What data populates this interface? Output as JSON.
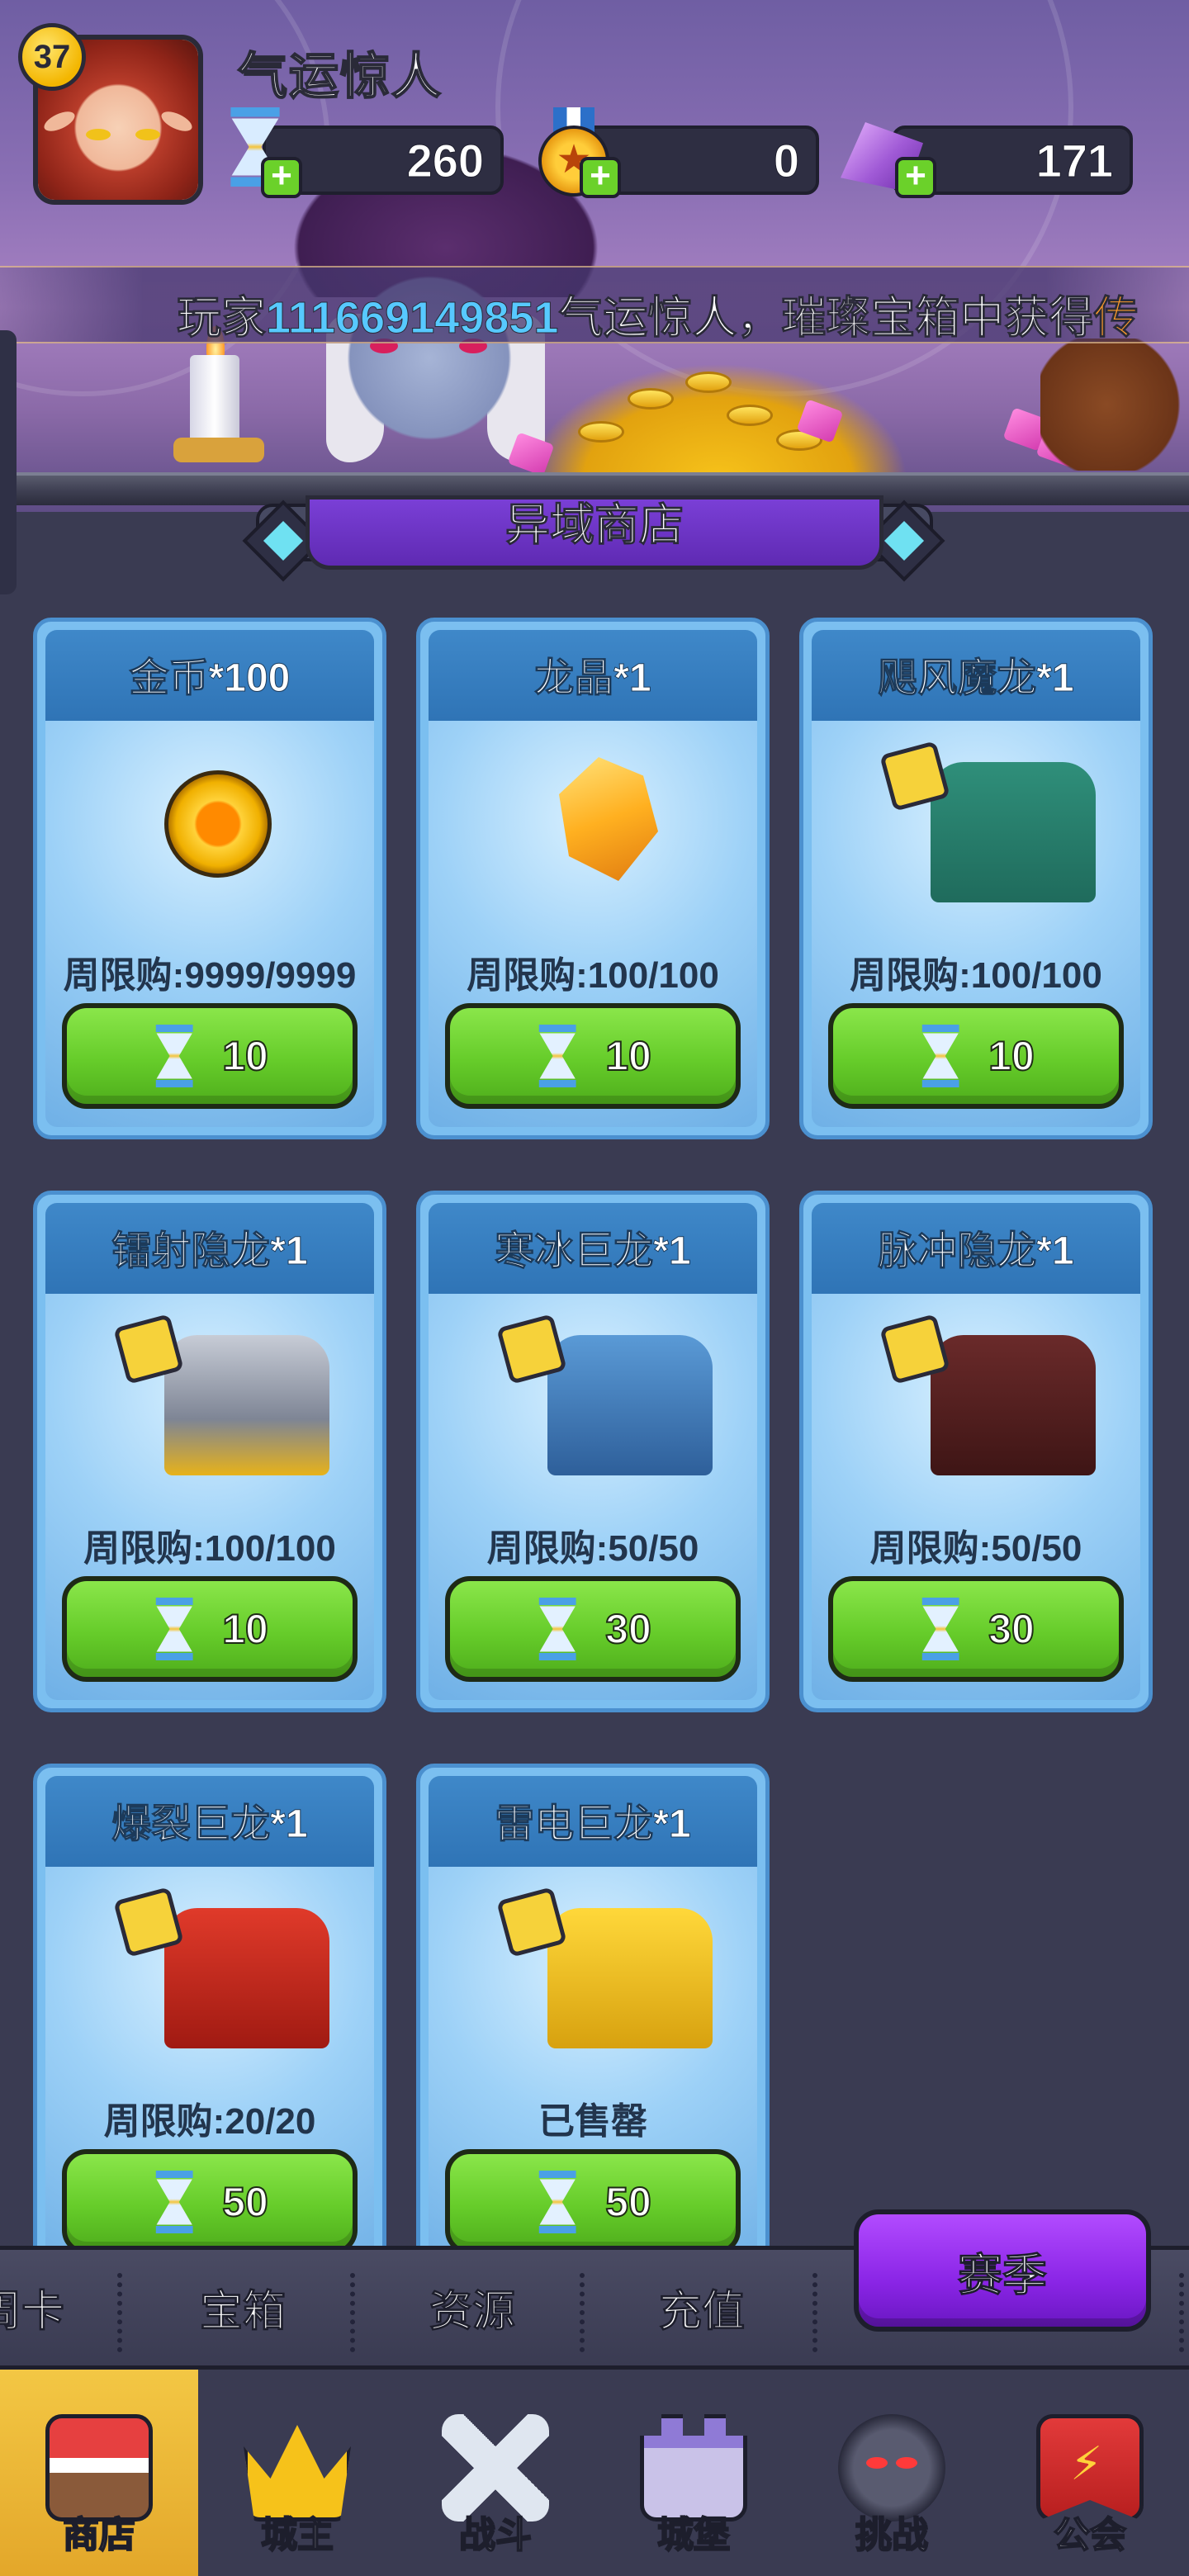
{
  "player": {
    "level": "37",
    "name": "气运惊人"
  },
  "resources": [
    {
      "icon": "hourglass-icon",
      "value": "260"
    },
    {
      "icon": "medal-icon",
      "value": "0"
    },
    {
      "icon": "crystal-icon",
      "value": "171"
    }
  ],
  "ticker": {
    "prefix": "玩家",
    "player_id": "111669149851",
    "suffix": "气运惊人，璀璨宝箱中获得",
    "item": "传"
  },
  "shop": {
    "title": "异域商店",
    "items": [
      {
        "name": "金币*100",
        "limit": "周限购:9999/9999",
        "price": "10",
        "art": "gold-coin-icon"
      },
      {
        "name": "龙晶*1",
        "limit": "周限购:100/100",
        "price": "10",
        "art": "dragon-crystal-icon"
      },
      {
        "name": "飓风魔龙*1",
        "limit": "周限购:100/100",
        "price": "10",
        "art": "hurricane-dragon-icon"
      },
      {
        "name": "镭射隐龙*1",
        "limit": "周限购:100/100",
        "price": "10",
        "art": "laser-dragon-icon"
      },
      {
        "name": "寒冰巨龙*1",
        "limit": "周限购:50/50",
        "price": "30",
        "art": "ice-dragon-icon"
      },
      {
        "name": "脉冲隐龙*1",
        "limit": "周限购:50/50",
        "price": "30",
        "art": "pulse-dragon-icon"
      },
      {
        "name": "爆裂巨龙*1",
        "limit": "周限购:20/20",
        "price": "50",
        "art": "burst-dragon-icon"
      },
      {
        "name": "雷电巨龙*1",
        "limit": "已售罄",
        "price": "50",
        "art": "thunder-dragon-icon"
      }
    ]
  },
  "tabs": {
    "items": [
      "周卡",
      "宝箱",
      "资源",
      "充值"
    ],
    "season": "赛季"
  },
  "nav": [
    {
      "label": "商店",
      "icon": "shop-icon",
      "active": true
    },
    {
      "label": "城主",
      "icon": "crown-icon",
      "active": false
    },
    {
      "label": "战斗",
      "icon": "swords-icon",
      "active": false
    },
    {
      "label": "城堡",
      "icon": "castle-icon",
      "active": false
    },
    {
      "label": "挑战",
      "icon": "demon-icon",
      "active": false
    },
    {
      "label": "公会",
      "icon": "guild-banner-icon",
      "active": false
    }
  ],
  "colors": {
    "background": "#3a3b52",
    "card": "#7bbff0",
    "buy_button": "#66cc2a",
    "season_button": "#8a25e6",
    "active_nav": "#f3c744",
    "ticker_id": "#57c9ff"
  }
}
